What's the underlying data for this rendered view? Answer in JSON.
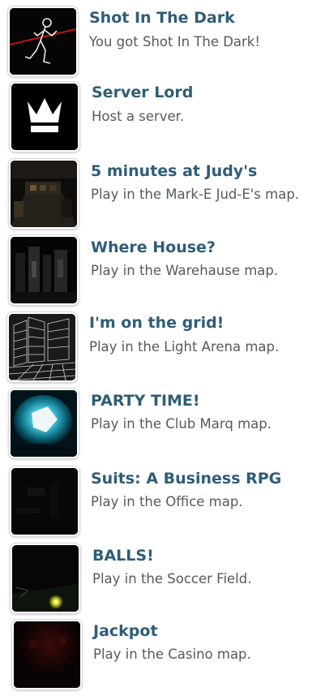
{
  "achievements": [
    {
      "title": "Shot In The Dark",
      "description": "You got Shot In The Dark!",
      "icon": "stick-figure-laser-icon"
    },
    {
      "title": "Server Lord",
      "description": "Host a server.",
      "icon": "crown-icon"
    },
    {
      "title": "5 minutes at Judy's",
      "description": "Play in the Mark-E Jud-E's map.",
      "icon": "judys-room-thumbnail"
    },
    {
      "title": "Where House?",
      "description": "Play in the Warehause map.",
      "icon": "warehouse-thumbnail"
    },
    {
      "title": "I'm on the grid!",
      "description": "Play in the Light Arena map.",
      "icon": "light-grid-thumbnail"
    },
    {
      "title": "PARTY TIME!",
      "description": "Play in the Club Marq map.",
      "icon": "club-light-thumbnail"
    },
    {
      "title": "Suits: A Business RPG",
      "description": "Play in the Office map.",
      "icon": "dark-office-thumbnail"
    },
    {
      "title": "BALLS!",
      "description": "Play in the Soccer Field.",
      "icon": "soccer-field-thumbnail"
    },
    {
      "title": "Jackpot",
      "description": "Play in the Casino map.",
      "icon": "casino-thumbnail"
    }
  ],
  "colors": {
    "title": "#2e5d78",
    "description": "#555a5e",
    "laser": "#c0141c"
  }
}
